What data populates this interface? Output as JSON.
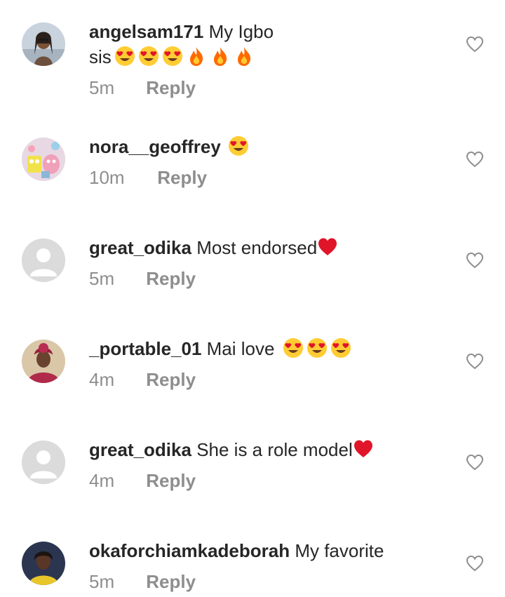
{
  "comments": [
    {
      "username": "angelsam171",
      "text_line1": "My Igbo",
      "text_line2": "sis",
      "emojis": [
        "heart-eyes",
        "heart-eyes",
        "heart-eyes",
        "fire",
        "fire",
        "fire"
      ],
      "time": "5m",
      "reply_label": "Reply",
      "avatar": "photo"
    },
    {
      "username": "nora__geoffrey",
      "text": "",
      "emojis": [
        "heart-eyes"
      ],
      "time": "10m",
      "reply_label": "Reply",
      "avatar": "cartoon"
    },
    {
      "username": "great_odika",
      "text": "Most endorsed",
      "emojis": [
        "red-heart"
      ],
      "time": "5m",
      "reply_label": "Reply",
      "avatar": "default"
    },
    {
      "username": "_portable_01",
      "text": "Mai love",
      "emojis": [
        "heart-eyes",
        "heart-eyes",
        "heart-eyes"
      ],
      "time": "4m",
      "reply_label": "Reply",
      "avatar": "photo"
    },
    {
      "username": "great_odika",
      "text": "She is a role model",
      "emojis": [
        "red-heart"
      ],
      "time": "4m",
      "reply_label": "Reply",
      "avatar": "default"
    },
    {
      "username": "okaforchiamkadeborah",
      "text": "My favorite",
      "emojis": [],
      "time": "5m",
      "reply_label": "Reply",
      "avatar": "photo"
    }
  ],
  "colors": {
    "text": "#262626",
    "secondary": "#8e8e8e",
    "default_avatar_bg": "#dbdbdb",
    "emoji_yellow": "#ffcc33",
    "heart_red": "#e0152a",
    "fire_orange": "#ff6a00"
  }
}
